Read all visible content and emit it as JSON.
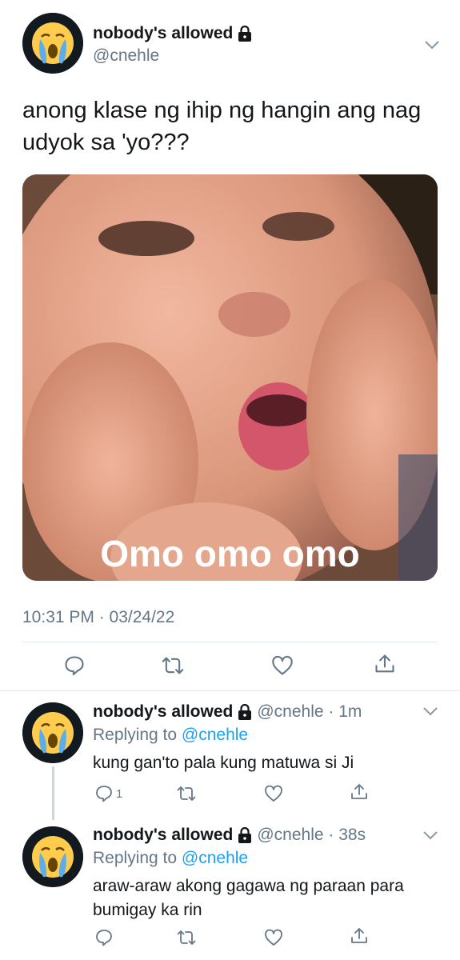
{
  "tweet": {
    "name": "nobody's allowed",
    "handle": "@cnehle",
    "text_line1": "anong klase ng ihip ng hangin ang nag",
    "text_line2": "udyok sa 'yo???",
    "media_caption": "Omo omo omo",
    "timestamp": "10:31 PM · 03/24/22"
  },
  "replies": [
    {
      "name": "nobody's allowed",
      "meta": "@cnehle · 1m",
      "replying_prefix": "Replying to ",
      "replying_handle": "@cnehle",
      "text": "kung gan'to pala kung matuwa si Ji",
      "reply_count": "1"
    },
    {
      "name": "nobody's allowed",
      "meta": "@cnehle · 38s",
      "replying_prefix": "Replying to ",
      "replying_handle": "@cnehle",
      "text_line1": "araw-araw akong gagawa ng paraan para",
      "text_line2": "bumigay ka rin"
    }
  ],
  "icons": {
    "avatar": "crying-emoji-icon",
    "lock": "lock-icon",
    "menu": "chevron-down-icon",
    "reply": "reply-icon",
    "retweet": "retweet-icon",
    "like": "heart-icon",
    "share": "share-icon"
  },
  "colors": {
    "text": "#14171a",
    "secondary": "#657786",
    "link": "#1da1f2",
    "divider": "#e1e8ed",
    "avatar_bg": "#121a20",
    "emoji_face": "#ffcc4d"
  }
}
